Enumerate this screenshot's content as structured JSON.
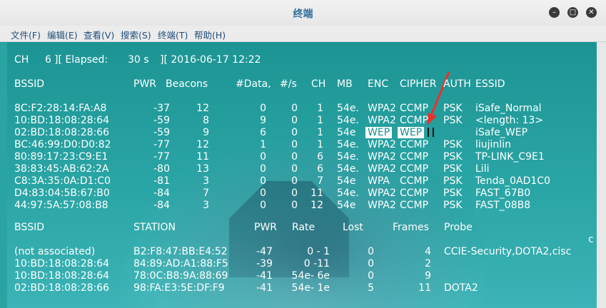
{
  "window": {
    "title": "终端",
    "buttons": {
      "minimize": "–",
      "maximize": "□",
      "close": "✕"
    }
  },
  "menu": [
    "文件(F)",
    "编辑(E)",
    "查看(V)",
    "搜索(S)",
    "终端(T)",
    "帮助(H)"
  ],
  "status": {
    "ch": "CH",
    "ch_value": "6",
    "elapsed_label": "][ Elapsed:",
    "elapsed_value": "30 s",
    "timestamp": "][ 2016-06-17 12:22"
  },
  "ap_headers": [
    "BSSID",
    "PWR",
    "Beacons",
    "#Data,",
    "#/s",
    "CH",
    "MB",
    "ENC",
    "CIPHER",
    "AUTH",
    "ESSID"
  ],
  "ap_rows": [
    [
      "8C:F2:28:14:FA:A8",
      "-37",
      "12",
      "0",
      "0",
      "1",
      "54e.",
      "WPA2",
      "CCMP",
      "PSK",
      "iSafe_Normal"
    ],
    [
      "10:BD:18:08:28:64",
      "-59",
      "8",
      "9",
      "0",
      "1",
      "54e.",
      "WPA2",
      "CCMP",
      "PSK",
      "<length: 13>"
    ],
    [
      "02:BD:18:08:28:66",
      "-59",
      "9",
      "6",
      "0",
      "1",
      "54e",
      "WEP",
      "WEP",
      "",
      "iSafe_WEP"
    ],
    [
      "BC:46:99:D0:D0:82",
      "-77",
      "12",
      "1",
      "0",
      "1",
      "54e.",
      "WPA2",
      "CCMP",
      "PSK",
      "liujinlin"
    ],
    [
      "80:89:17:23:C9:E1",
      "-77",
      "11",
      "0",
      "0",
      "6",
      "54e.",
      "WPA2",
      "CCMP",
      "PSK",
      "TP-LINK_C9E1"
    ],
    [
      "38:83:45:AB:62:2A",
      "-80",
      "13",
      "0",
      "0",
      "6",
      "54e.",
      "WPA2",
      "CCMP",
      "PSK",
      "Lili"
    ],
    [
      "C8:3A:35:0A:D1:C0",
      "-81",
      "3",
      "0",
      "0",
      "7",
      "54e",
      "WPA",
      "CCMP",
      "PSK",
      "Tenda_0AD1C0"
    ],
    [
      "D4:83:04:5B:67:B0",
      "-84",
      "7",
      "0",
      "0",
      "11",
      "54e.",
      "WPA2",
      "CCMP",
      "PSK",
      "FAST_67B0"
    ],
    [
      "44:97:5A:57:08:B8",
      "-84",
      "3",
      "0",
      "0",
      "12",
      "54e",
      "WPA2",
      "CCMP",
      "PSK",
      "FAST_08B8"
    ]
  ],
  "sta_headers": [
    "BSSID",
    "STATION",
    "PWR",
    "Rate",
    "Lost",
    "Frames",
    "Probe"
  ],
  "sta_wrap": "c",
  "sta_rows": [
    [
      "(not associated)",
      "B2:F8:47:BB:E4:52",
      "-47",
      "0 - 1",
      "0",
      "4",
      "CCIE-Security,DOTA2,cisc"
    ],
    [
      "10:BD:18:08:28:64",
      "84:89:AD:A1:88:F5",
      "-39",
      "0 -11",
      "0",
      "2",
      ""
    ],
    [
      "10:BD:18:08:28:64",
      "78:0C:B8:9A:88:69",
      "-41",
      "54e- 6e",
      "0",
      "9",
      ""
    ],
    [
      "02:BD:18:08:28:66",
      "98:FA:E3:5E:DF:F9",
      "-41",
      "54e- 1e",
      "5",
      "11",
      "DOTA2"
    ]
  ],
  "colors": {
    "terminal_bg": "#2aa3a3",
    "text": "#ffffff",
    "highlight_bg": "#ffffff",
    "arrow": "#e8322a",
    "menu_text": "#1d4e7a",
    "title_text": "#2e6f9e"
  }
}
